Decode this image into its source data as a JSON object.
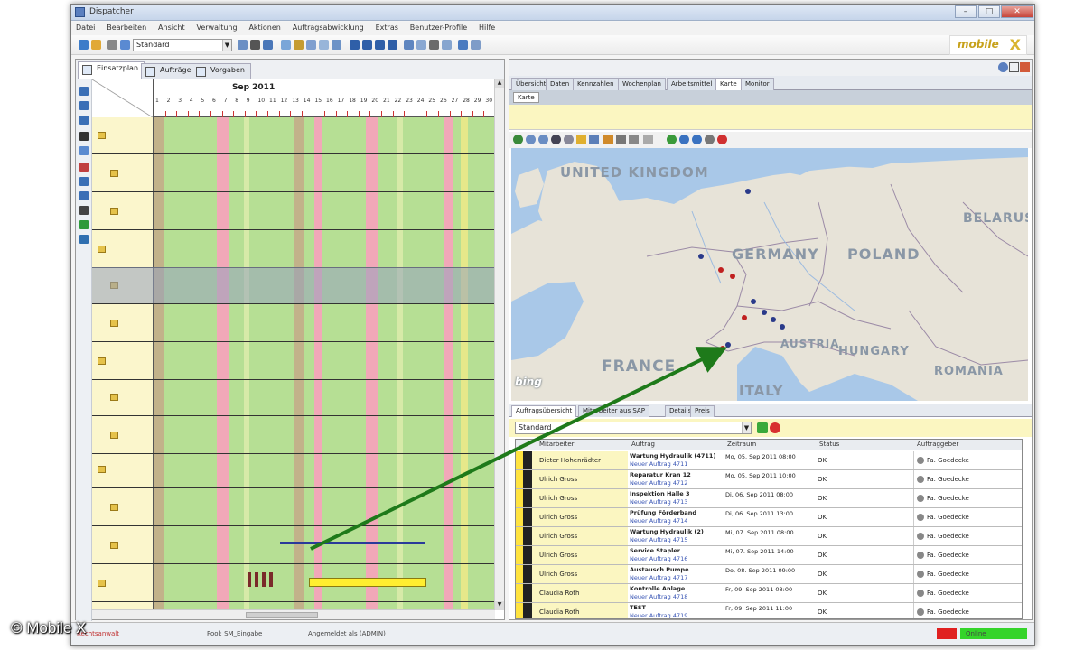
{
  "window": {
    "title": "Dispatcher"
  },
  "menu": [
    "Datei",
    "Bearbeiten",
    "Ansicht",
    "Verwaltung",
    "Aktionen",
    "Auftragsabwicklung",
    "Extras",
    "Benutzer-Profile",
    "Hilfe"
  ],
  "toolbar": {
    "combo_value": "Standard"
  },
  "brand": {
    "logo": "mobile",
    "mark": "X"
  },
  "left_tabs": [
    "Einsatzplan",
    "Aufträge",
    "Vorgaben"
  ],
  "gantt": {
    "month": "Sep 2011"
  },
  "right_tabs": [
    "Übersicht",
    "Daten",
    "Kennzahlen",
    "Wochenplan",
    "Arbeitsmittel",
    "Karte",
    "Monitor"
  ],
  "right_subtab": "Karte",
  "map": {
    "countries": [
      "UNITED KINGDOM",
      "GERMANY",
      "POLAND",
      "BELARUS",
      "FRANCE",
      "AUSTRIA",
      "HUNGARY",
      "ROMANIA",
      "ITALY"
    ],
    "credit": "bing"
  },
  "bottom_tabs": [
    "Auftragsübersicht",
    "Mitarbeiter aus SAP",
    "Details",
    "Preis"
  ],
  "filter": {
    "value": "Standard"
  },
  "table": {
    "headers": [
      "Mitarbeiter",
      "Auftrag",
      "Zeitraum",
      "Status",
      "Auftraggeber"
    ],
    "rows": [
      {
        "name": "Dieter Hohenrädter",
        "order": "Wartung Hydraulik (4711)",
        "ref": "Neuer Auftrag 4711",
        "time": "Mo, 05. Sep 2011 08:00",
        "status": "OK",
        "client": "Fa. Goedecke"
      },
      {
        "name": "Ulrich Gross",
        "order": "Reparatur Kran 12",
        "ref": "Neuer Auftrag 4712",
        "time": "Mo, 05. Sep 2011 10:00",
        "status": "OK",
        "client": "Fa. Goedecke"
      },
      {
        "name": "Ulrich Gross",
        "order": "Inspektion Halle 3",
        "ref": "Neuer Auftrag 4713",
        "time": "Di, 06. Sep 2011 08:00",
        "status": "OK",
        "client": "Fa. Goedecke"
      },
      {
        "name": "Ulrich Gross",
        "order": "Prüfung Förderband",
        "ref": "Neuer Auftrag 4714",
        "time": "Di, 06. Sep 2011 13:00",
        "status": "OK",
        "client": "Fa. Goedecke"
      },
      {
        "name": "Ulrich Gross",
        "order": "Wartung Hydraulik (2)",
        "ref": "Neuer Auftrag 4715",
        "time": "Mi, 07. Sep 2011 08:00",
        "status": "OK",
        "client": "Fa. Goedecke"
      },
      {
        "name": "Ulrich Gross",
        "order": "Service Stapler",
        "ref": "Neuer Auftrag 4716",
        "time": "Mi, 07. Sep 2011 14:00",
        "status": "OK",
        "client": "Fa. Goedecke"
      },
      {
        "name": "Ulrich Gross",
        "order": "Austausch Pumpe",
        "ref": "Neuer Auftrag 4717",
        "time": "Do, 08. Sep 2011 09:00",
        "status": "OK",
        "client": "Fa. Goedecke"
      },
      {
        "name": "Claudia Roth",
        "order": "Kontrolle Anlage",
        "ref": "Neuer Auftrag 4718",
        "time": "Fr, 09. Sep 2011 08:00",
        "status": "OK",
        "client": "Fa. Goedecke"
      },
      {
        "name": "Claudia Roth",
        "order": "TEST",
        "ref": "Neuer Auftrag 4719",
        "time": "Fr, 09. Sep 2011 11:00",
        "status": "OK",
        "client": "Fa. Goedecke"
      }
    ]
  },
  "status": {
    "left": "Rechtsanwalt",
    "center": "Pool: SM_Eingabe",
    "right": "Angemeldet als (ADMIN)",
    "indicator": "Online"
  },
  "colors": {
    "gantt_green": "#b6df94",
    "gantt_red": "#f1a8b8",
    "gantt_brown": "#c2b28a",
    "panel_yellow": "#fbf6c1",
    "arrow": "#1e7a1a"
  },
  "copyright": "© Mobile X"
}
